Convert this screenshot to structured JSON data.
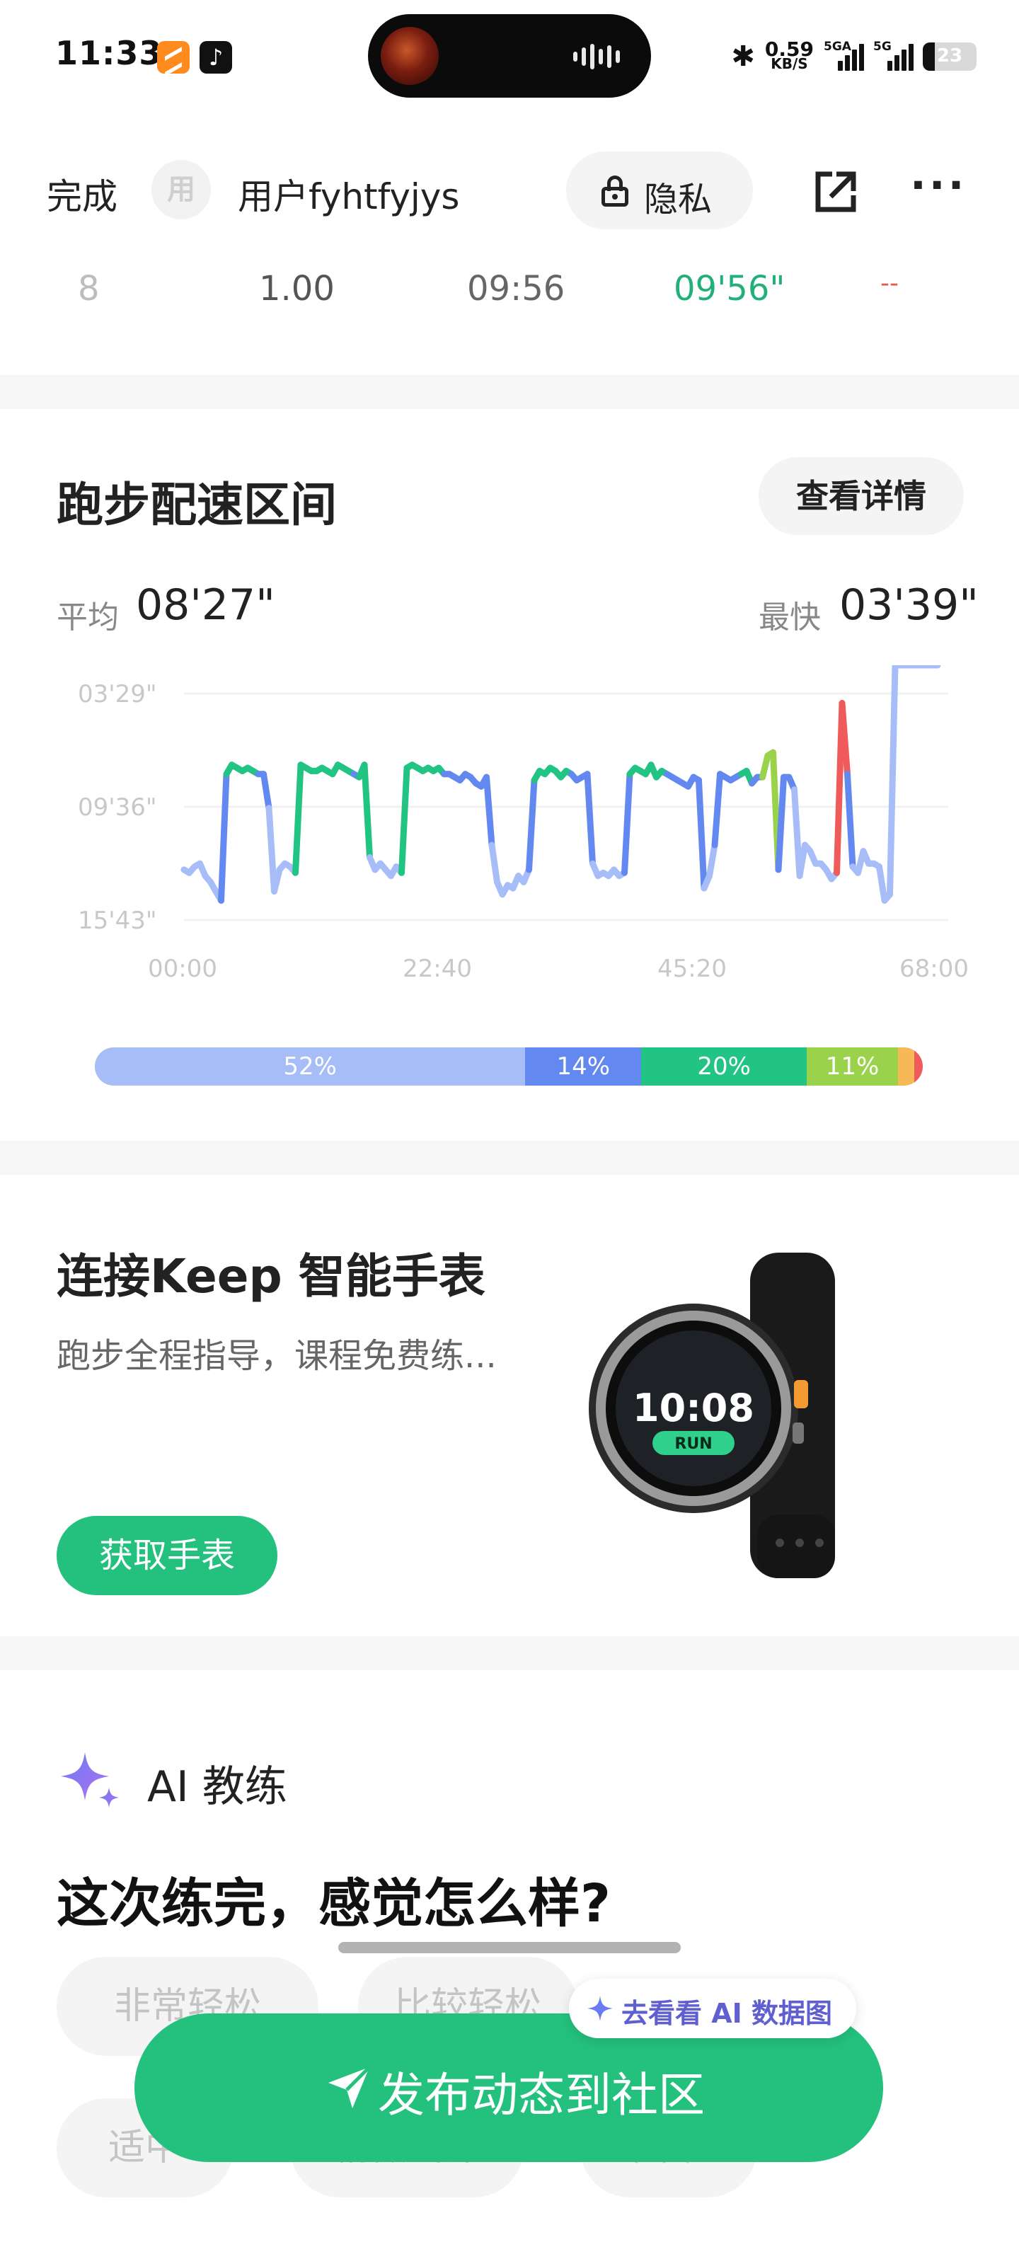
{
  "status_bar": {
    "time": "11:33",
    "net_speed_value": "0.59",
    "net_speed_unit": "KB/S",
    "signal1_label": "5GA",
    "signal2_label": "5G",
    "battery": "23",
    "battery_level": 0.23
  },
  "nav": {
    "done_label": "完成",
    "avatar_text": "用",
    "username": "用户fyhtfyjys",
    "privacy_label": "隐私"
  },
  "split_row": {
    "index": "8",
    "distance": "1.00",
    "time": "09:56",
    "pace": "09'56\"",
    "extra": "--"
  },
  "pace_zone": {
    "title": "跑步配速区间",
    "details_label": "查看详情",
    "avg_label": "平均",
    "avg_value": "08'27\"",
    "fastest_label": "最快",
    "fastest_value": "03'39\""
  },
  "chart_data": {
    "type": "line",
    "title": "",
    "xlabel": "",
    "ylabel": "",
    "y_ticks": [
      "03'29\"",
      "09'36\"",
      "15'43\""
    ],
    "x_ticks": [
      "00:00",
      "22:40",
      "45:20",
      "68:00"
    ],
    "x_unit": "minutes",
    "xlim": [
      0,
      72
    ],
    "ylim_pace_seconds": [
      209,
      943
    ],
    "x": [
      0,
      0.5,
      1,
      1.5,
      2,
      2.5,
      3,
      3.5,
      4,
      4.5,
      5,
      5.5,
      6,
      6.5,
      7,
      7.5,
      8,
      8.5,
      9,
      9.5,
      10,
      10.5,
      11,
      11.5,
      12,
      12.5,
      13,
      13.5,
      14,
      14.5,
      15,
      15.5,
      16,
      16.5,
      17,
      17.5,
      18,
      18.5,
      19,
      19.5,
      20,
      20.5,
      21,
      21.5,
      22,
      22.5,
      23,
      23.5,
      24,
      24.5,
      25,
      25.5,
      26,
      26.5,
      27,
      27.5,
      28,
      28.5,
      29,
      29.5,
      30,
      30.5,
      31,
      31.5,
      32,
      32.5,
      33,
      33.5,
      34,
      34.5,
      35,
      35.5,
      36,
      36.5,
      37,
      37.5,
      38,
      38.5,
      39,
      39.5,
      40,
      40.5,
      41,
      41.5,
      42,
      42.5,
      43,
      43.5,
      44,
      44.5,
      45,
      45.5,
      46,
      46.5,
      47,
      47.5,
      48,
      48.5,
      49,
      49.5,
      50,
      50.5,
      51,
      51.5,
      52,
      52.5,
      53,
      53.5,
      54,
      54.5,
      55,
      55.5,
      56,
      56.5,
      57,
      57.5,
      58,
      58.5,
      59,
      59.5,
      60,
      60.5,
      61,
      61.5,
      62,
      62.5,
      63,
      63.5,
      64,
      64.5,
      65,
      65.5,
      66,
      66.5,
      67,
      67.5,
      68,
      68.5,
      69,
      69.5,
      70,
      70.5,
      71
    ],
    "pace_seconds": [
      780,
      790,
      770,
      760,
      800,
      820,
      850,
      880,
      470,
      440,
      450,
      460,
      450,
      460,
      470,
      470,
      580,
      850,
      780,
      760,
      770,
      790,
      440,
      450,
      460,
      460,
      450,
      460,
      470,
      440,
      450,
      460,
      470,
      480,
      440,
      740,
      780,
      760,
      780,
      800,
      770,
      790,
      450,
      440,
      450,
      460,
      450,
      460,
      450,
      470,
      470,
      480,
      490,
      470,
      480,
      500,
      510,
      480,
      700,
      820,
      860,
      830,
      840,
      800,
      820,
      780,
      490,
      460,
      470,
      450,
      460,
      480,
      460,
      470,
      490,
      480,
      470,
      760,
      800,
      790,
      800,
      780,
      800,
      790,
      470,
      450,
      460,
      470,
      440,
      480,
      460,
      470,
      480,
      490,
      500,
      510,
      480,
      490,
      840,
      800,
      700,
      470,
      480,
      490,
      480,
      470,
      460,
      500,
      480,
      480,
      410,
      400,
      780,
      480,
      480,
      520,
      800,
      700,
      720,
      760,
      760,
      780,
      810,
      790,
      240,
      470,
      770,
      790,
      720,
      760,
      760,
      770,
      880,
      860
    ]
  },
  "pace_zones": [
    {
      "pct": "52%",
      "value": 52,
      "color": "#a6bdf7"
    },
    {
      "pct": "14%",
      "value": 14,
      "color": "#6388f0"
    },
    {
      "pct": "20%",
      "value": 20,
      "color": "#22c484"
    },
    {
      "pct": "11%",
      "value": 11,
      "color": "#9bd24b"
    },
    {
      "pct": "",
      "value": 2,
      "color": "#f7b955"
    },
    {
      "pct": "",
      "value": 1,
      "color": "#ef5a5a"
    }
  ],
  "watch_card": {
    "title": "连接Keep 智能手表",
    "desc": "跑步全程指导，课程免费练...",
    "button": "获取手表",
    "watch_time": "10:08",
    "watch_badge": "RUN"
  },
  "ai_coach": {
    "label": "AI 教练",
    "question": "这次练完，感觉怎么样?",
    "chips": [
      "非常轻松",
      "比较轻松",
      "适中",
      "稍微出汗",
      "困难"
    ],
    "popover": "去看看 AI 数据图",
    "publish": "发布动态到社区"
  }
}
